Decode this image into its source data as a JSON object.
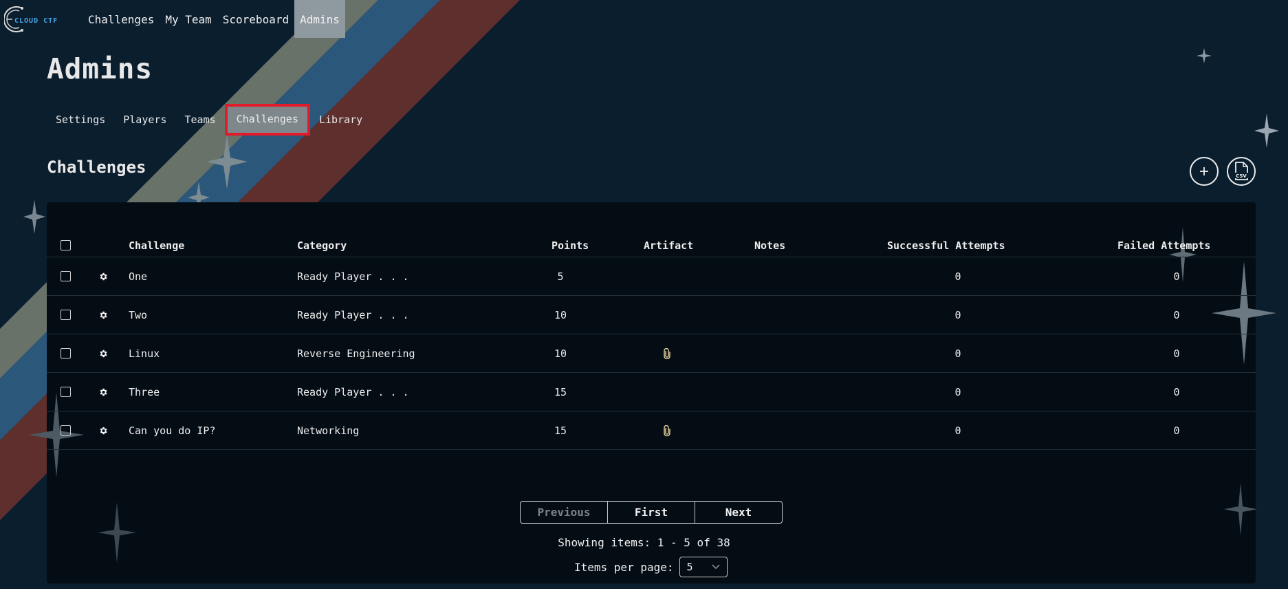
{
  "nav": {
    "logo_text": "CLOUD CTF",
    "links": [
      "Challenges",
      "My Team",
      "Scoreboard",
      "Admins"
    ],
    "active_index": 3
  },
  "page": {
    "title": "Admins"
  },
  "subnav": {
    "items": [
      "Settings",
      "Players",
      "Teams",
      "Challenges",
      "Library"
    ],
    "active_index": 3
  },
  "section": {
    "title": "Challenges",
    "add_icon": "plus-icon",
    "csv_icon": "csv-file-icon",
    "csv_label": "CSV"
  },
  "table": {
    "headers": {
      "challenge": "Challenge",
      "category": "Category",
      "points": "Points",
      "artifact": "Artifact",
      "notes": "Notes",
      "successful": "Successful Attempts",
      "failed": "Failed Attempts"
    },
    "rows": [
      {
        "challenge": "One",
        "category": "Ready Player . . .",
        "points": "5",
        "artifact": false,
        "notes": "",
        "successful": "0",
        "failed": "0"
      },
      {
        "challenge": "Two",
        "category": "Ready Player . . .",
        "points": "10",
        "artifact": false,
        "notes": "",
        "successful": "0",
        "failed": "0"
      },
      {
        "challenge": "Linux",
        "category": "Reverse Engineering",
        "points": "10",
        "artifact": true,
        "notes": "",
        "successful": "0",
        "failed": "0"
      },
      {
        "challenge": "Three",
        "category": "Ready Player . . .",
        "points": "15",
        "artifact": false,
        "notes": "",
        "successful": "0",
        "failed": "0"
      },
      {
        "challenge": "Can you do IP?",
        "category": "Networking",
        "points": "15",
        "artifact": true,
        "notes": "",
        "successful": "0",
        "failed": "0"
      }
    ]
  },
  "pagination": {
    "previous": "Previous",
    "first": "First",
    "next": "Next",
    "showing": "Showing items: 1 - 5 of 38",
    "per_page_label": "Items per page:",
    "per_page_value": "5"
  },
  "colors": {
    "background": "#0b1e2e",
    "panel": "#050d14",
    "stripe_gray": "#7d8577",
    "stripe_blue": "#2f5f86",
    "stripe_red": "#6b2f2b",
    "highlight_outline": "#e21b2a"
  }
}
